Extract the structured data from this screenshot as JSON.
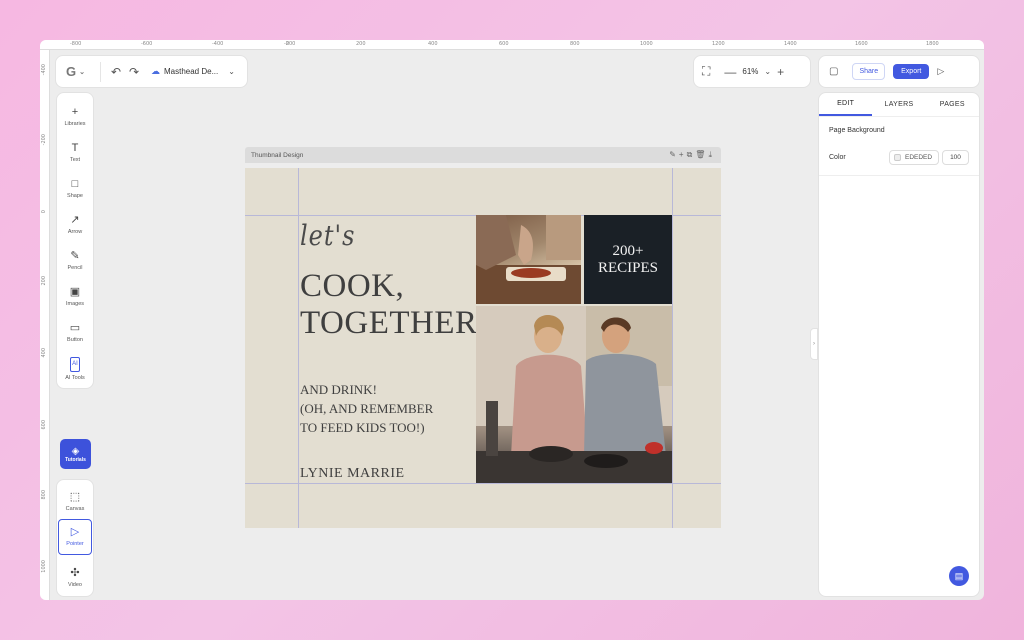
{
  "rulers": {
    "top": [
      "-800",
      "-600",
      "-400",
      "-200",
      "0",
      "200",
      "400",
      "600",
      "800",
      "1000",
      "1200",
      "1400",
      "1600",
      "1800"
    ],
    "left": [
      "-400",
      "-200",
      "0",
      "200",
      "400",
      "600",
      "800",
      "1000"
    ]
  },
  "toolbar": {
    "logo": "G",
    "document_title": "Masthead De...",
    "zoom": "61%",
    "share_label": "Share",
    "export_label": "Export"
  },
  "tools": [
    {
      "icon": "+",
      "label": "Libraries",
      "name": "libraries"
    },
    {
      "icon": "T",
      "label": "Text",
      "name": "text"
    },
    {
      "icon": "□",
      "label": "Shape",
      "name": "shape"
    },
    {
      "icon": "↗",
      "label": "Arrow",
      "name": "arrow"
    },
    {
      "icon": "✎",
      "label": "Pencil",
      "name": "pencil"
    },
    {
      "icon": "▣",
      "label": "Images",
      "name": "images"
    },
    {
      "icon": "▭",
      "label": "Button",
      "name": "button"
    },
    {
      "icon": "AI",
      "label": "AI Tools",
      "name": "ai-tools"
    }
  ],
  "tutorials_label": "Tutorials",
  "bottom_tools": [
    {
      "icon": "⬚",
      "label": "Canvas",
      "name": "canvas"
    },
    {
      "icon": "▷",
      "label": "Pointer",
      "name": "pointer"
    },
    {
      "icon": "✣",
      "label": "Video",
      "name": "video"
    }
  ],
  "canvas": {
    "frame_title": "Thumbnail Design",
    "lets": "let's",
    "headline_1": "COOK,",
    "headline_2": "TOGETHER",
    "sub_1": "AND DRINK!",
    "sub_2": "(OH, AND REMEMBER",
    "sub_3": "TO FEED KIDS TOO!)",
    "author": "LYNIE MARRIE",
    "recipes_count": "200+",
    "recipes_label": "RECIPES"
  },
  "right_panel": {
    "tabs": [
      "EDIT",
      "LAYERS",
      "PAGES"
    ],
    "section_title": "Page Background",
    "color_label": "Color",
    "color_value": "EDEDED",
    "opacity_value": "100"
  },
  "colors": {
    "accent": "#4259e0",
    "artboard": "#e3ded1",
    "recipes_bg": "#1a2026"
  }
}
